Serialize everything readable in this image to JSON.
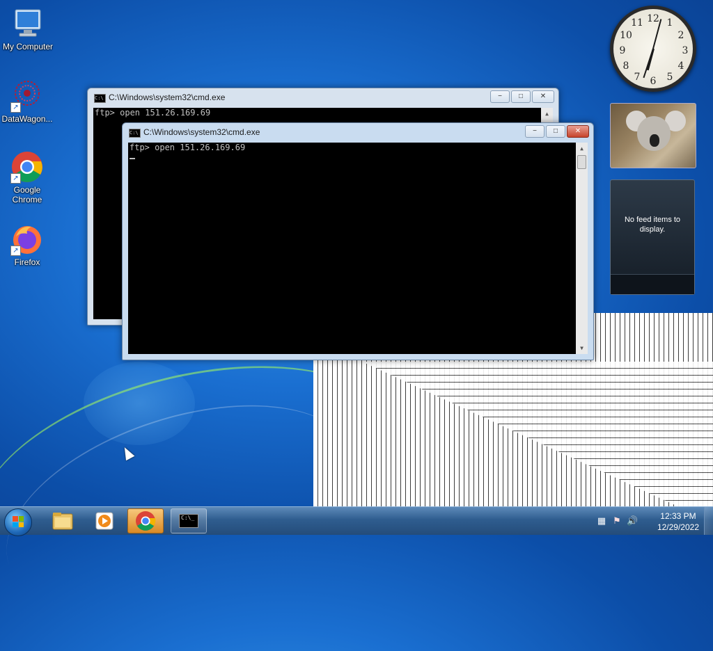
{
  "desktop": {
    "icons": [
      {
        "label": "My Computer"
      },
      {
        "label": "DataWagon..."
      },
      {
        "label": "Google Chrome"
      },
      {
        "label": "Firefox"
      }
    ]
  },
  "windows": {
    "back": {
      "title": "C:\\Windows\\system32\\cmd.exe",
      "line1": "ftp> open 151.26.169.69"
    },
    "front": {
      "title": "C:\\Windows\\system32\\cmd.exe",
      "line1": "ftp> open 151.26.169.69"
    }
  },
  "window_buttons": {
    "minimize": "−",
    "maximize": "□",
    "close": "✕"
  },
  "gadgets": {
    "clock_numbers": [
      "12",
      "1",
      "2",
      "3",
      "4",
      "5",
      "6",
      "7",
      "8",
      "9",
      "10",
      "11"
    ],
    "feed_message": "No feed items to display."
  },
  "taskbar": {
    "time": "12:33 PM",
    "date": "12/29/2022",
    "cmd_icon_text": "C:\\_"
  },
  "icons": {
    "start": "windows-logo-icon",
    "explorer": "folder-icon",
    "media": "media-player-icon",
    "chrome": "chrome-icon",
    "cmd": "cmd-icon"
  }
}
